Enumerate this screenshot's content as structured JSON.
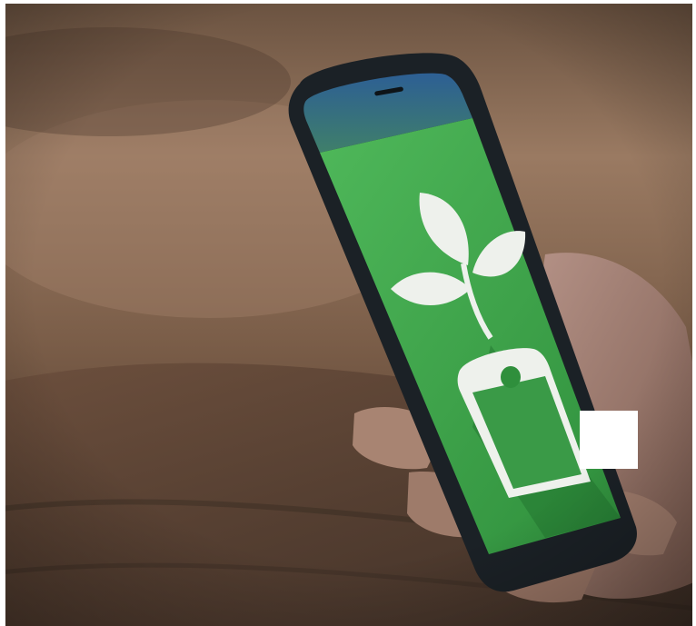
{
  "image": {
    "subject": "phone-with-plant-app-icon",
    "colors": {
      "background_wood": "#7a5a44",
      "table_dark": "#4a372c",
      "screen_green": "#3aa24a",
      "screen_top_blue": "#2a5d8f",
      "icon_white": "#eef1ec",
      "phone_body": "#1c2226",
      "hand_skin": "#a88472",
      "redaction_box": "#ffffff"
    }
  }
}
